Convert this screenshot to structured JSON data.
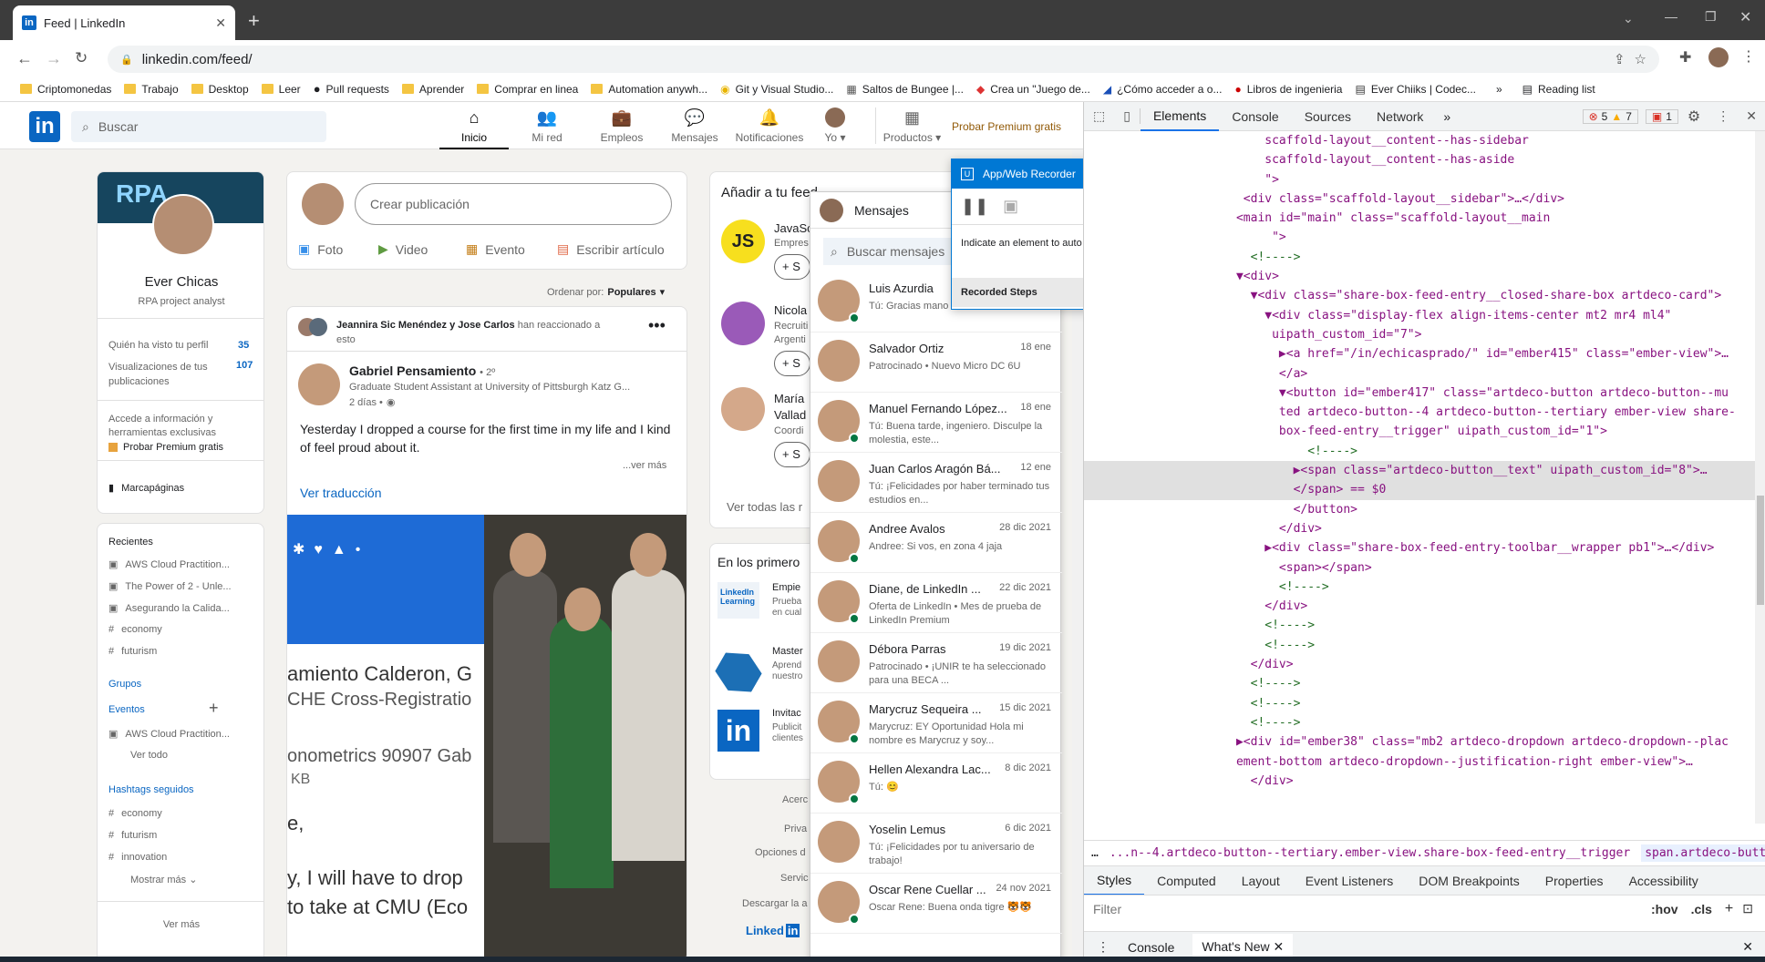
{
  "browser": {
    "tab_title": "Feed | LinkedIn",
    "url": "linkedin.com/feed/",
    "bookmarks": [
      "Criptomonedas",
      "Trabajo",
      "Desktop",
      "Leer",
      "Pull requests",
      "Aprender",
      "Comprar en linea",
      "Automation anywh...",
      "Git y Visual Studio...",
      "Saltos de Bungee |...",
      "Crea un \"Juego de...",
      "¿Cómo acceder a o...",
      "Libros de ingenieria",
      "Ever Chiiks | Codec..."
    ],
    "reading_list": "Reading list"
  },
  "linkedin": {
    "search_placeholder": "Buscar",
    "nav": [
      "Inicio",
      "Mi red",
      "Empleos",
      "Mensajes",
      "Notificaciones",
      "Yo",
      "Productos"
    ],
    "premium_link": "Probar Premium gratis",
    "profile": {
      "banner_text": "RPA",
      "name": "Ever Chicas",
      "headline": "RPA project analyst",
      "stat1_label": "Quién ha visto tu perfil",
      "stat1_value": "35",
      "stat2_label": "Visualizaciones de tus publicaciones",
      "stat2_value": "107",
      "premium_text": "Accede a información y herramientas exclusivas",
      "premium_cta": "Probar Premium gratis",
      "bookmarks": "Marcapáginas"
    },
    "recent": {
      "title": "Recientes",
      "items": [
        "AWS Cloud Practition...",
        "The Power of 2 - Unle...",
        "Asegurando la Calida...",
        "economy",
        "futurism"
      ],
      "groups": "Grupos",
      "events": "Eventos",
      "event_item": "AWS Cloud Practition...",
      "see_all": "Ver todo",
      "hashtags_title": "Hashtags seguidos",
      "hashtags": [
        "economy",
        "futurism",
        "innovation"
      ],
      "show_more": "Mostrar más",
      "see_more": "Ver más"
    },
    "share": {
      "placeholder": "Crear publicación",
      "actions": [
        "Foto",
        "Video",
        "Evento",
        "Escribir artículo"
      ],
      "sort_label": "Ordenar por:",
      "sort_value": "Populares"
    },
    "post": {
      "reactors": "Jeannira Sic Menéndez y Jose Carlos",
      "reacted": "han reaccionado a esto",
      "author": "Gabriel Pensamiento",
      "degree": "• 2º",
      "author_headline": "Graduate Student Assistant at University of Pittsburgh Katz G...",
      "time": "2 días •",
      "text": "Yesterday I dropped a course for the first time in my life and I kind of feel proud about it.",
      "more": "...ver más",
      "translate": "Ver traducción",
      "img_text_lines": [
        "amiento Calderon, G",
        "CHE Cross-Registratio",
        "onometrics 90907 Gab",
        "KB",
        "e,",
        "y, I will have to drop",
        "to take at CMU (Eco"
      ]
    },
    "right": {
      "title": "Añadir a tu feed",
      "items": [
        {
          "name": "JavaSc",
          "sub": "Empres"
        },
        {
          "name": "Nicola",
          "sub": "Recruiti Argenti"
        },
        {
          "name": "María Vallad",
          "sub": "Coordi"
        }
      ],
      "follow": "+ S",
      "see_all": "Ver todas las r",
      "promo_title": "En los primero",
      "promos": [
        {
          "name": "Empie",
          "sub": "Prueba en cual"
        },
        {
          "name": "Master",
          "sub": "Aprend nuestro"
        },
        {
          "name": "Invitac",
          "sub": "Publicit clientes"
        }
      ],
      "footer": [
        "Acerc",
        "Priva",
        "Opciones d",
        "Servic",
        "Descargar la a"
      ]
    },
    "messages": {
      "title": "Mensajes",
      "search": "Buscar mensajes",
      "items": [
        {
          "name": "Luis Azurdia",
          "date": "",
          "preview": "Tú: Gracias mano",
          "online": true
        },
        {
          "name": "Salvador Ortiz",
          "date": "18 ene",
          "preview": "Patrocinado • Nuevo Micro DC 6U",
          "online": false
        },
        {
          "name": "Manuel Fernando López...",
          "date": "18 ene",
          "preview": "Tú: Buena tarde, ingeniero. Disculpe la molestia, este...",
          "online": true
        },
        {
          "name": "Juan Carlos Aragón Bá...",
          "date": "12 ene",
          "preview": "Tú: ¡Felicidades por haber terminado tus estudios en...",
          "online": false
        },
        {
          "name": "Andree Avalos",
          "date": "28 dic 2021",
          "preview": "Andree: Si vos, en zona 4 jaja",
          "online": true
        },
        {
          "name": "Diane, de LinkedIn ...",
          "date": "22 dic 2021",
          "preview": "Oferta de LinkedIn • Mes de prueba de LinkedIn Premium",
          "online": true
        },
        {
          "name": "Débora Parras",
          "date": "19 dic 2021",
          "preview": "Patrocinado • ¡UNIR te ha seleccionado para una BECA ...",
          "online": false
        },
        {
          "name": "Marycruz Sequeira ...",
          "date": "15 dic 2021",
          "preview": "Marycruz: EY Oportunidad Hola mi nombre es Marycruz y soy...",
          "online": true
        },
        {
          "name": "Hellen Alexandra Lac...",
          "date": "8 dic 2021",
          "preview": "Tú: 😊",
          "online": true
        },
        {
          "name": "Yoselin Lemus",
          "date": "6 dic 2021",
          "preview": "Tú: ¡Felicidades por tu aniversario de trabajo!",
          "online": false
        },
        {
          "name": "Oscar Rene Cuellar ...",
          "date": "24 nov 2021",
          "preview": "Oscar Rene: Buena onda tigre 🐯🐯",
          "online": true
        }
      ]
    }
  },
  "recorder": {
    "title": "App/Web Recorder",
    "help": "?",
    "instruction": "Indicate an element to auto detect the action",
    "steps_label": "Recorded Steps"
  },
  "devtools": {
    "tabs": [
      "Elements",
      "Console",
      "Sources",
      "Network"
    ],
    "errors": "5",
    "warnings": "7",
    "issues": "1",
    "dom_lines": [
      "          scaffold-layout__content--has-sidebar",
      "          scaffold-layout__content--has-aside",
      "",
      "          \">",
      "       <div class=\"scaffold-layout__sidebar\">…</div>",
      "      <main id=\"main\" class=\"scaffold-layout__main",
      "",
      "           \">",
      "        <!---->",
      "      ▼<div>",
      "        ▼<div class=\"share-box-feed-entry__closed-share-box artdeco-card\">",
      "          ▼<div class=\"display-flex align-items-center mt2 mr4 ml4\"",
      "           uipath_custom_id=\"7\">",
      "            ▶<a href=\"/in/echicasprado/\" id=\"ember415\" class=\"ember-view\">…",
      "            </a>",
      "            ▼<button id=\"ember417\" class=\"artdeco-button artdeco-button--mu",
      "            ted artdeco-button--4 artdeco-button--tertiary ember-view share-",
      "            box-feed-entry__trigger\" uipath_custom_id=\"1\">",
      "                <!---->",
      "              ▶<span class=\"artdeco-button__text\" uipath_custom_id=\"8\">…",
      "              </span> == $0",
      "              </button>",
      "            </div>",
      "          ▶<div class=\"share-box-feed-entry-toolbar__wrapper pb1\">…</div>",
      "            <span></span>",
      "            <!---->",
      "          </div>",
      "          <!---->",
      "          <!---->",
      "        </div>",
      "        <!---->",
      "        <!---->",
      "        <!---->",
      "      ▶<div id=\"ember38\" class=\"mb2 artdeco-dropdown artdeco-dropdown--plac",
      "      ement-bottom artdeco-dropdown--justification-right ember-view\">…",
      "        </div>"
    ],
    "breadcrumb1": "...n--4.artdeco-button--tertiary.ember-view.share-box-feed-entry__trigger",
    "breadcrumb2": "span.artdeco-button__text",
    "style_tabs": [
      "Styles",
      "Computed",
      "Layout",
      "Event Listeners",
      "DOM Breakpoints",
      "Properties",
      "Accessibility"
    ],
    "filter_placeholder": "Filter",
    "hov": ":hov",
    "cls": ".cls",
    "drawer_tabs": [
      "Console",
      "What's New"
    ]
  }
}
